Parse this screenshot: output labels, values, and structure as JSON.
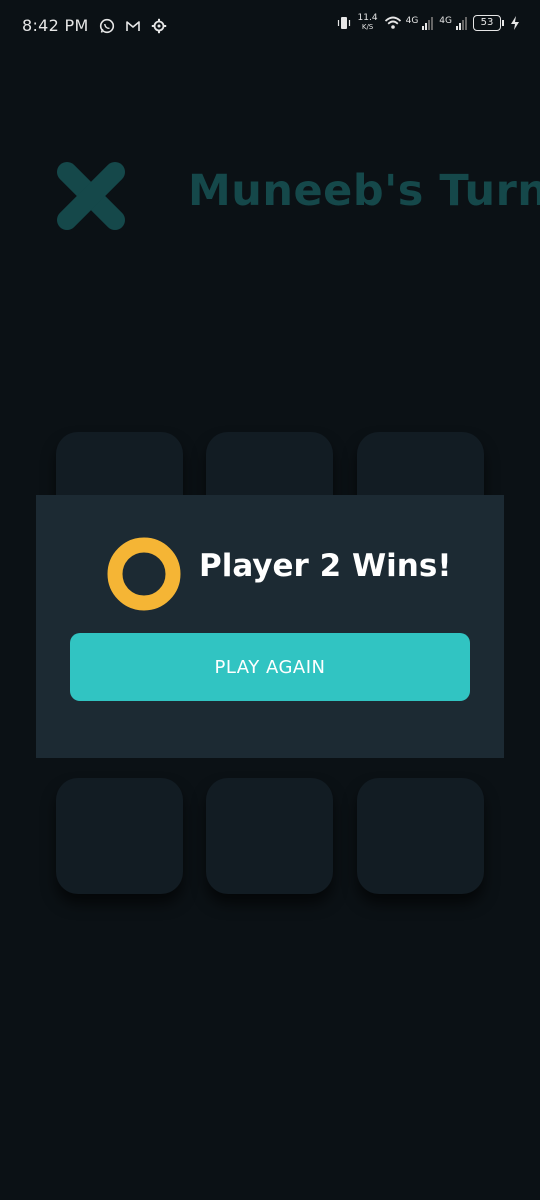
{
  "status_bar": {
    "time": "8:42 PM",
    "net_speed_value": "11.4",
    "net_speed_unit": "K/S",
    "sim1_gen": "4G",
    "sim2_gen": "4G",
    "battery": "53",
    "icons": [
      "whatsapp-icon",
      "gmail-icon",
      "settings-icon",
      "vibrate-icon",
      "wifi-icon",
      "signal-icon",
      "battery-icon",
      "charging-icon"
    ]
  },
  "header": {
    "turn_text": "Muneeb's Turn",
    "turn_icon": "x-mark-icon",
    "turn_color": "#15484a"
  },
  "board": {
    "cells": [
      "",
      "",
      "",
      "",
      "",
      "",
      "",
      "",
      ""
    ]
  },
  "dialog": {
    "winner_icon": "o-mark-icon",
    "winner_color": "#f5b535",
    "message": "Player 2 Wins!",
    "button_label": "PLAY AGAIN",
    "button_color": "#31c4c2",
    "background": "#1c2a33"
  }
}
